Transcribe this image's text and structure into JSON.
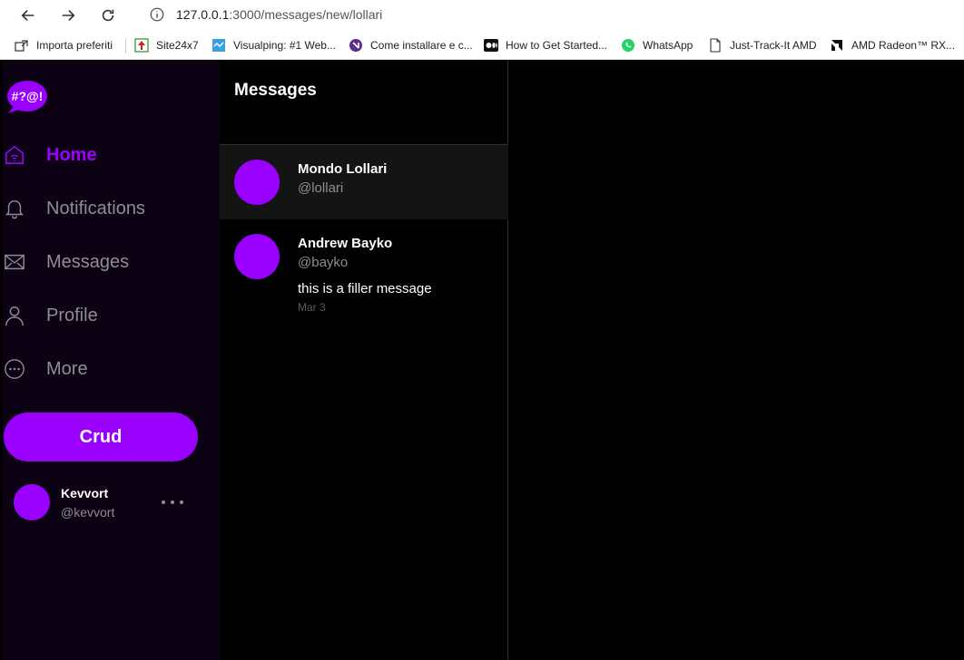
{
  "browser": {
    "url_host": "127.0.0.1",
    "url_path": ":3000/messages/new/lollari",
    "bookmarks": [
      {
        "label": "Importa preferiti",
        "icon": "import-icon"
      },
      {
        "label": "Site24x7",
        "icon": "site24x7-icon"
      },
      {
        "label": "Visualping: #1 Web...",
        "icon": "visualping-icon"
      },
      {
        "label": "Come installare e c...",
        "icon": "site-icon"
      },
      {
        "label": "How to Get Started...",
        "icon": "medium-icon"
      },
      {
        "label": "WhatsApp",
        "icon": "whatsapp-icon"
      },
      {
        "label": "Just-Track-It AMD",
        "icon": "page-icon"
      },
      {
        "label": "AMD Radeon™ RX...",
        "icon": "amd-icon"
      }
    ]
  },
  "sidebar": {
    "logo_text": "#?@!",
    "items": [
      {
        "label": "Home",
        "icon": "home-icon",
        "active": true
      },
      {
        "label": "Notifications",
        "icon": "bell-icon",
        "active": false
      },
      {
        "label": "Messages",
        "icon": "envelope-icon",
        "active": false
      },
      {
        "label": "Profile",
        "icon": "user-icon",
        "active": false
      },
      {
        "label": "More",
        "icon": "more-circle-icon",
        "active": false
      }
    ],
    "action_button": "Crud",
    "account": {
      "name": "Kevvort",
      "handle": "@kevvort"
    }
  },
  "messages": {
    "title": "Messages",
    "conversations": [
      {
        "name": "Mondo Lollari",
        "handle": "@lollari",
        "message": "",
        "date": ""
      },
      {
        "name": "Andrew Bayko",
        "handle": "@bayko",
        "message": "this is a filler message",
        "date": "Mar 3"
      }
    ]
  },
  "colors": {
    "accent": "#9900ff",
    "sidebar_bg": "#0c0214",
    "background": "#000000"
  }
}
